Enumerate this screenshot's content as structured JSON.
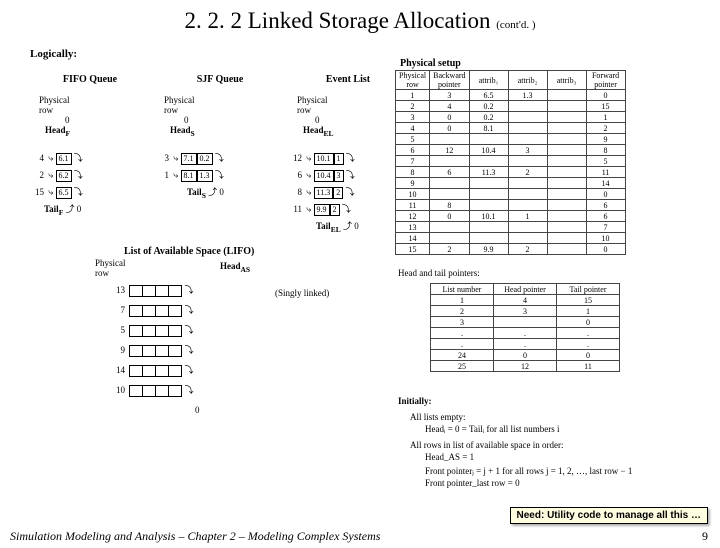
{
  "title": "2. 2. 2  Linked Storage Allocation",
  "contd": "(cont'd. )",
  "logically": "Logically:",
  "phys_setup_label": "Physical setup",
  "fifo": {
    "title": "FIFO Queue",
    "phys_label": "Physical\nrow",
    "head": "Head",
    "head_sub": "F",
    "tail": "Tail",
    "tail_sub": "F",
    "rows": [
      "4",
      "2",
      "15"
    ],
    "cells": [
      [
        "6.1"
      ],
      [
        "6.2"
      ],
      [
        "6.5"
      ]
    ],
    "end": "0"
  },
  "sjf": {
    "title": "SJF Queue",
    "phys_label": "Physical\nrow",
    "head": "Head",
    "head_sub": "S",
    "tail": "Tail",
    "tail_sub": "S",
    "rows": [
      "3",
      "1"
    ],
    "cells": [
      [
        "7.1",
        "0.2"
      ],
      [
        "8.1",
        "1.3"
      ]
    ],
    "end": "0"
  },
  "evlist": {
    "title": "Event List",
    "phys_label": "Physical\nrow",
    "head": "Head",
    "head_sub": "EL",
    "tail": "Tail",
    "tail_sub": "EL",
    "rows": [
      "12",
      "6",
      "8",
      "11"
    ],
    "cells": [
      [
        "10.1",
        "1"
      ],
      [
        "10.4",
        "3"
      ],
      [
        "11.3",
        "2"
      ],
      [
        "9.9",
        "2"
      ]
    ],
    "end": "0"
  },
  "lifo": {
    "title": "List of Available Space (LIFO)",
    "phys_label": "Physical\nrow",
    "head": "Head",
    "head_sub": "AS",
    "rows": [
      "13",
      "7",
      "5",
      "9",
      "14",
      "10"
    ],
    "end": "0",
    "singly": "(Singly linked)"
  },
  "phys_table": {
    "headers": [
      "Physical\nrow",
      "Backward\npointer",
      "attrib₁",
      "attrib₂",
      "attrib₃",
      "Forward\npointer"
    ],
    "rows": [
      [
        "1",
        "3",
        "6.5",
        "1.3",
        "",
        "0"
      ],
      [
        "2",
        "4",
        "0.2",
        "",
        "",
        "15"
      ],
      [
        "3",
        "0",
        "0.2",
        "",
        "",
        "1"
      ],
      [
        "4",
        "0",
        "8.1",
        "",
        "",
        "2"
      ],
      [
        "5",
        "",
        "",
        "",
        "",
        "9"
      ],
      [
        "6",
        "12",
        "10.4",
        "3",
        "",
        "8"
      ],
      [
        "7",
        "",
        "",
        "",
        "",
        "5"
      ],
      [
        "8",
        "6",
        "11.3",
        "2",
        "",
        "11"
      ],
      [
        "9",
        "",
        "",
        "",
        "",
        "14"
      ],
      [
        "10",
        "",
        "",
        "",
        "",
        "0"
      ],
      [
        "11",
        "8",
        "",
        "",
        "",
        "6"
      ],
      [
        "12",
        "0",
        "10.1",
        "1",
        "",
        "6"
      ],
      [
        "13",
        "",
        "",
        "",
        "",
        "7"
      ],
      [
        "14",
        "",
        "",
        "",
        "",
        "10"
      ],
      [
        "15",
        "2",
        "9.9",
        "2",
        "",
        "0"
      ]
    ]
  },
  "ptr_label": "Head and tail pointers:",
  "ptr_table": {
    "headers": [
      "List number",
      "Head pointer",
      "Tail pointer"
    ],
    "rows": [
      [
        "1",
        "4",
        "15"
      ],
      [
        "2",
        "3",
        "1"
      ],
      [
        "3",
        "",
        "0"
      ],
      [
        ".",
        ".",
        "."
      ],
      [
        ".",
        ".",
        "."
      ],
      [
        "24",
        "0",
        "0"
      ],
      [
        "25",
        "12",
        "11"
      ]
    ]
  },
  "initially": {
    "label": "Initially:",
    "line1": "All lists empty:",
    "line2": "Headᵢ = 0 = Tailᵢ for all list numbers i",
    "line3": "All rows in list of available space in order:",
    "line4": "Head_AS = 1",
    "line5": "Front pointerⱼ = j + 1 for all rows j = 1, 2, …, last row − 1",
    "line6": "Front pointer_last row = 0"
  },
  "note": "Need:  Utility code to manage all this …",
  "footer": "Simulation Modeling and Analysis – Chapter 2 – Modeling Complex Systems",
  "page": "9"
}
